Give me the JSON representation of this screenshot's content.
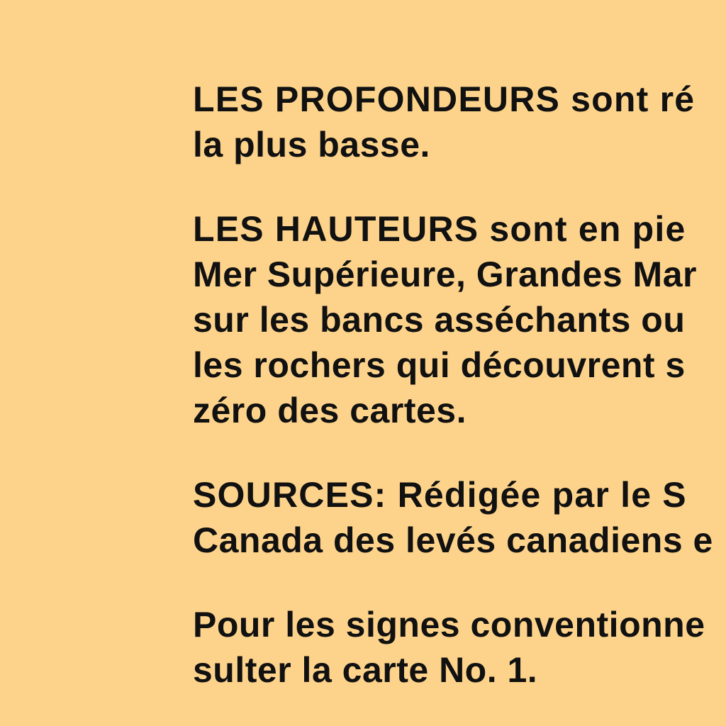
{
  "document": {
    "background_color": "#fdd38b",
    "text_color": "#111111",
    "paragraphs": [
      {
        "lines": [
          "LES PROFONDEURS sont ré",
          "la plus basse."
        ]
      },
      {
        "lines": [
          "LES HAUTEURS sont en pie",
          "Mer Supérieure, Grandes Mar",
          "sur les bancs asséchants ou",
          "les rochers qui découvrent s",
          "zéro des cartes."
        ]
      },
      {
        "lines": [
          "SOURCES: Rédigée par le S",
          "Canada des levés canadiens e"
        ]
      },
      {
        "lines": [
          "Pour les signes conventionne",
          "sulter la carte No. 1."
        ]
      }
    ]
  }
}
